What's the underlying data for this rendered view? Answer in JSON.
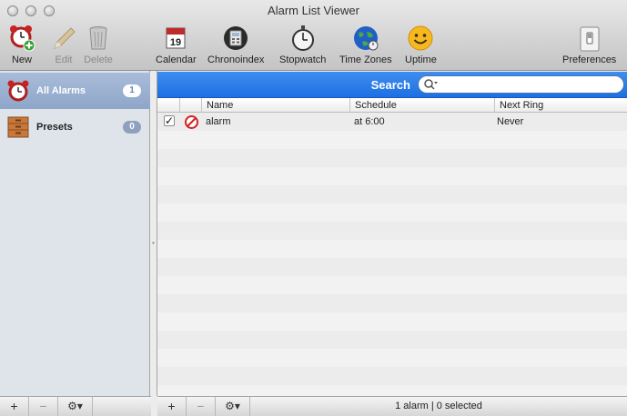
{
  "window": {
    "title": "Alarm List Viewer"
  },
  "toolbar": {
    "new": "New",
    "edit": "Edit",
    "delete": "Delete",
    "calendar": "Calendar",
    "calendar_icon_text": "19",
    "chronoindex": "Chronoindex",
    "stopwatch": "Stopwatch",
    "time_zones": "Time Zones",
    "uptime": "Uptime",
    "preferences": "Preferences"
  },
  "sidebar": {
    "items": [
      {
        "label": "All Alarms",
        "count": "1",
        "selected": true,
        "icon": "alarm-clock-icon"
      },
      {
        "label": "Presets",
        "count": "0",
        "selected": false,
        "icon": "drawer-icon"
      }
    ]
  },
  "search": {
    "label": "Search",
    "value": "",
    "placeholder": ""
  },
  "table": {
    "columns": [
      "Name",
      "Schedule",
      "Next Ring"
    ],
    "rows": [
      {
        "enabled": true,
        "status_icon": "no-entry-icon",
        "name": "alarm",
        "schedule": "at 6:00",
        "next_ring": "Never"
      }
    ]
  },
  "bottom": {
    "add": "+",
    "remove": "−",
    "gear": "⚙▾",
    "status": "1 alarm | 0 selected"
  },
  "colors": {
    "selection": "#8ea6c9",
    "search_bar": "#2a7ae8",
    "accent_red": "#d32020"
  }
}
